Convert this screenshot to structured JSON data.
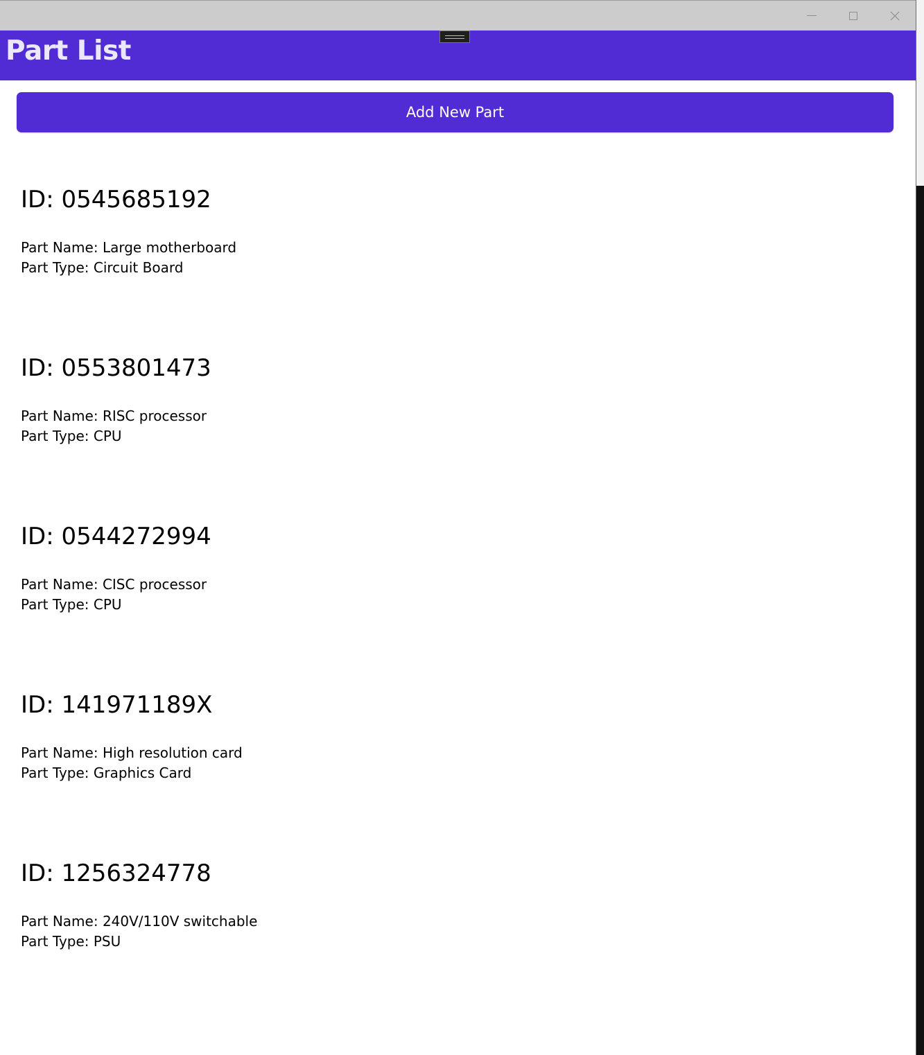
{
  "window": {
    "title_bar": {
      "minimize_icon": "minimize-icon",
      "maximize_icon": "maximize-icon",
      "close_icon": "close-icon"
    }
  },
  "header": {
    "title": "Part List",
    "accent_color": "#512bd4"
  },
  "actions": {
    "add_new_part_label": "Add New Part"
  },
  "parts": [
    {
      "id": "ID: 0545685192",
      "name": "Part Name: Large motherboard",
      "type": "Part Type: Circuit Board"
    },
    {
      "id": "ID: 0553801473",
      "name": "Part Name: RISC processor",
      "type": "Part Type: CPU"
    },
    {
      "id": "ID: 0544272994",
      "name": "Part Name: CISC processor",
      "type": "Part Type: CPU"
    },
    {
      "id": "ID: 141971189X",
      "name": "Part Name: High resolution card",
      "type": "Part Type: Graphics Card"
    },
    {
      "id": "ID: 1256324778",
      "name": "Part Name: 240V/110V switchable",
      "type": "Part Type: PSU"
    }
  ]
}
